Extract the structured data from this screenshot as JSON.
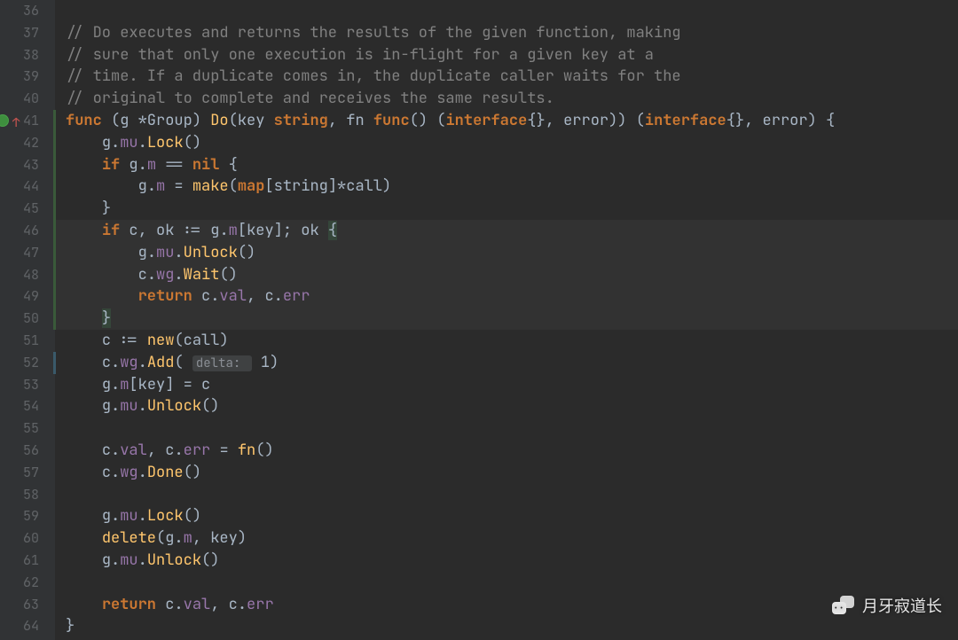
{
  "watermark": {
    "text": "月牙寂道长"
  },
  "hint": {
    "delta_label": "delta:",
    "delta_value": "1"
  },
  "gutter": {
    "start": 36,
    "marks": {
      "41": {
        "dot": true,
        "arrow": "↑"
      }
    }
  },
  "highlight": {
    "from": 46,
    "to": 50
  },
  "vbars": [
    {
      "from": 41,
      "to": 50,
      "class": ""
    },
    {
      "from": 52,
      "to": 52,
      "class": "blue"
    }
  ],
  "lines": [
    {
      "n": 36,
      "tokens": [
        {
          "t": "",
          "c": ""
        }
      ]
    },
    {
      "n": 37,
      "tokens": [
        {
          "t": "// Do executes and returns the results of the given function, making",
          "c": "c-cmt"
        }
      ]
    },
    {
      "n": 38,
      "tokens": [
        {
          "t": "// sure that only one execution is in-flight for a given key at a",
          "c": "c-cmt"
        }
      ]
    },
    {
      "n": 39,
      "tokens": [
        {
          "t": "// time. If a duplicate comes in, the duplicate caller waits for the",
          "c": "c-cmt"
        }
      ]
    },
    {
      "n": 40,
      "tokens": [
        {
          "t": "// original to complete and receives the same results.",
          "c": "c-cmt"
        }
      ]
    },
    {
      "n": 41,
      "tokens": [
        {
          "t": "func ",
          "c": "c-kw"
        },
        {
          "t": "(",
          "c": "c-punc"
        },
        {
          "t": "g ",
          "c": "c-id"
        },
        {
          "t": "*Group",
          "c": "c-ty"
        },
        {
          "t": ") ",
          "c": "c-punc"
        },
        {
          "t": "Do",
          "c": "c-fn"
        },
        {
          "t": "(",
          "c": "c-punc"
        },
        {
          "t": "key ",
          "c": "c-id"
        },
        {
          "t": "string",
          "c": "c-kw"
        },
        {
          "t": ", ",
          "c": "c-punc"
        },
        {
          "t": "fn ",
          "c": "c-id"
        },
        {
          "t": "func",
          "c": "c-kw"
        },
        {
          "t": "() (",
          "c": "c-punc"
        },
        {
          "t": "interface",
          "c": "c-kw"
        },
        {
          "t": "{}, ",
          "c": "c-punc"
        },
        {
          "t": "error",
          "c": "c-ty"
        },
        {
          "t": ")) (",
          "c": "c-punc"
        },
        {
          "t": "interface",
          "c": "c-kw"
        },
        {
          "t": "{}, ",
          "c": "c-punc"
        },
        {
          "t": "error",
          "c": "c-ty"
        },
        {
          "t": ") {",
          "c": "c-punc"
        }
      ]
    },
    {
      "n": 42,
      "indent": 1,
      "tokens": [
        {
          "t": "g",
          "c": "c-id"
        },
        {
          "t": ".",
          "c": "c-punc"
        },
        {
          "t": "mu",
          "c": "c-fld"
        },
        {
          "t": ".",
          "c": "c-punc"
        },
        {
          "t": "Lock",
          "c": "c-fn"
        },
        {
          "t": "()",
          "c": "c-punc"
        }
      ]
    },
    {
      "n": 43,
      "indent": 1,
      "tokens": [
        {
          "t": "if ",
          "c": "c-kw"
        },
        {
          "t": "g",
          "c": "c-id"
        },
        {
          "t": ".",
          "c": "c-punc"
        },
        {
          "t": "m",
          "c": "c-fld"
        },
        {
          "t": " == ",
          "c": "c-punc"
        },
        {
          "t": "nil ",
          "c": "c-kw"
        },
        {
          "t": "{",
          "c": "c-punc"
        }
      ]
    },
    {
      "n": 44,
      "indent": 2,
      "tokens": [
        {
          "t": "g",
          "c": "c-id"
        },
        {
          "t": ".",
          "c": "c-punc"
        },
        {
          "t": "m",
          "c": "c-fld"
        },
        {
          "t": " = ",
          "c": "c-punc"
        },
        {
          "t": "make",
          "c": "c-fn"
        },
        {
          "t": "(",
          "c": "c-punc"
        },
        {
          "t": "map",
          "c": "c-kw"
        },
        {
          "t": "[",
          "c": "c-punc"
        },
        {
          "t": "string",
          "c": "c-ty"
        },
        {
          "t": "]*call)",
          "c": "c-punc"
        }
      ]
    },
    {
      "n": 45,
      "indent": 1,
      "tokens": [
        {
          "t": "}",
          "c": "c-punc"
        }
      ]
    },
    {
      "n": 46,
      "indent": 1,
      "tokens": [
        {
          "t": "if ",
          "c": "c-kw"
        },
        {
          "t": "c",
          "c": "c-id"
        },
        {
          "t": ", ",
          "c": "c-punc"
        },
        {
          "t": "ok ",
          "c": "c-id"
        },
        {
          "t": ":= ",
          "c": "c-punc"
        },
        {
          "t": "g",
          "c": "c-id"
        },
        {
          "t": ".",
          "c": "c-punc"
        },
        {
          "t": "m",
          "c": "c-fld"
        },
        {
          "t": "[",
          "c": "c-punc"
        },
        {
          "t": "key",
          "c": "c-id"
        },
        {
          "t": "]; ",
          "c": "c-punc"
        },
        {
          "t": "ok ",
          "c": "c-id"
        },
        {
          "t": "{",
          "c": "c-punc c-hl"
        }
      ]
    },
    {
      "n": 47,
      "indent": 2,
      "tokens": [
        {
          "t": "g",
          "c": "c-id"
        },
        {
          "t": ".",
          "c": "c-punc"
        },
        {
          "t": "mu",
          "c": "c-fld"
        },
        {
          "t": ".",
          "c": "c-punc"
        },
        {
          "t": "Unlock",
          "c": "c-fn"
        },
        {
          "t": "()",
          "c": "c-punc"
        }
      ]
    },
    {
      "n": 48,
      "indent": 2,
      "tokens": [
        {
          "t": "c",
          "c": "c-id"
        },
        {
          "t": ".",
          "c": "c-punc"
        },
        {
          "t": "wg",
          "c": "c-fld"
        },
        {
          "t": ".",
          "c": "c-punc"
        },
        {
          "t": "Wait",
          "c": "c-fn"
        },
        {
          "t": "()",
          "c": "c-punc"
        }
      ]
    },
    {
      "n": 49,
      "indent": 2,
      "tokens": [
        {
          "t": "return ",
          "c": "c-kw"
        },
        {
          "t": "c",
          "c": "c-id"
        },
        {
          "t": ".",
          "c": "c-punc"
        },
        {
          "t": "val",
          "c": "c-fld"
        },
        {
          "t": ", ",
          "c": "c-punc"
        },
        {
          "t": "c",
          "c": "c-id"
        },
        {
          "t": ".",
          "c": "c-punc"
        },
        {
          "t": "err",
          "c": "c-fld"
        }
      ]
    },
    {
      "n": 50,
      "indent": 1,
      "tokens": [
        {
          "t": "}",
          "c": "c-punc c-hl"
        }
      ]
    },
    {
      "n": 51,
      "indent": 1,
      "tokens": [
        {
          "t": "c ",
          "c": "c-id"
        },
        {
          "t": ":= ",
          "c": "c-punc"
        },
        {
          "t": "new",
          "c": "c-fn"
        },
        {
          "t": "(",
          "c": "c-punc"
        },
        {
          "t": "call",
          "c": "c-ty"
        },
        {
          "t": ")",
          "c": "c-punc"
        }
      ]
    },
    {
      "n": 52,
      "indent": 1,
      "tokens": [
        {
          "t": "c",
          "c": "c-id"
        },
        {
          "t": ".",
          "c": "c-punc"
        },
        {
          "t": "wg",
          "c": "c-fld"
        },
        {
          "t": ".",
          "c": "c-punc"
        },
        {
          "t": "Add",
          "c": "c-fn"
        },
        {
          "t": "( ",
          "c": "c-punc"
        },
        {
          "t": "__HINT__",
          "c": "__HINT__"
        },
        {
          "t": ")",
          "c": "c-punc"
        }
      ]
    },
    {
      "n": 53,
      "indent": 1,
      "tokens": [
        {
          "t": "g",
          "c": "c-id"
        },
        {
          "t": ".",
          "c": "c-punc"
        },
        {
          "t": "m",
          "c": "c-fld"
        },
        {
          "t": "[",
          "c": "c-punc"
        },
        {
          "t": "key",
          "c": "c-id"
        },
        {
          "t": "] = ",
          "c": "c-punc"
        },
        {
          "t": "c",
          "c": "c-id"
        }
      ]
    },
    {
      "n": 54,
      "indent": 1,
      "tokens": [
        {
          "t": "g",
          "c": "c-id"
        },
        {
          "t": ".",
          "c": "c-punc"
        },
        {
          "t": "mu",
          "c": "c-fld"
        },
        {
          "t": ".",
          "c": "c-punc"
        },
        {
          "t": "Unlock",
          "c": "c-fn"
        },
        {
          "t": "()",
          "c": "c-punc"
        }
      ]
    },
    {
      "n": 55,
      "indent": 1,
      "tokens": []
    },
    {
      "n": 56,
      "indent": 1,
      "tokens": [
        {
          "t": "c",
          "c": "c-id"
        },
        {
          "t": ".",
          "c": "c-punc"
        },
        {
          "t": "val",
          "c": "c-fld"
        },
        {
          "t": ", ",
          "c": "c-punc"
        },
        {
          "t": "c",
          "c": "c-id"
        },
        {
          "t": ".",
          "c": "c-punc"
        },
        {
          "t": "err",
          "c": "c-fld"
        },
        {
          "t": " = ",
          "c": "c-punc"
        },
        {
          "t": "fn",
          "c": "c-fn"
        },
        {
          "t": "()",
          "c": "c-punc"
        }
      ]
    },
    {
      "n": 57,
      "indent": 1,
      "tokens": [
        {
          "t": "c",
          "c": "c-id"
        },
        {
          "t": ".",
          "c": "c-punc"
        },
        {
          "t": "wg",
          "c": "c-fld"
        },
        {
          "t": ".",
          "c": "c-punc"
        },
        {
          "t": "Done",
          "c": "c-fn"
        },
        {
          "t": "()",
          "c": "c-punc"
        }
      ]
    },
    {
      "n": 58,
      "indent": 1,
      "tokens": []
    },
    {
      "n": 59,
      "indent": 1,
      "tokens": [
        {
          "t": "g",
          "c": "c-id"
        },
        {
          "t": ".",
          "c": "c-punc"
        },
        {
          "t": "mu",
          "c": "c-fld"
        },
        {
          "t": ".",
          "c": "c-punc"
        },
        {
          "t": "Lock",
          "c": "c-fn"
        },
        {
          "t": "()",
          "c": "c-punc"
        }
      ]
    },
    {
      "n": 60,
      "indent": 1,
      "tokens": [
        {
          "t": "delete",
          "c": "c-fn"
        },
        {
          "t": "(",
          "c": "c-punc"
        },
        {
          "t": "g",
          "c": "c-id"
        },
        {
          "t": ".",
          "c": "c-punc"
        },
        {
          "t": "m",
          "c": "c-fld"
        },
        {
          "t": ", ",
          "c": "c-punc"
        },
        {
          "t": "key",
          "c": "c-id"
        },
        {
          "t": ")",
          "c": "c-punc"
        }
      ]
    },
    {
      "n": 61,
      "indent": 1,
      "tokens": [
        {
          "t": "g",
          "c": "c-id"
        },
        {
          "t": ".",
          "c": "c-punc"
        },
        {
          "t": "mu",
          "c": "c-fld"
        },
        {
          "t": ".",
          "c": "c-punc"
        },
        {
          "t": "Unlock",
          "c": "c-fn"
        },
        {
          "t": "()",
          "c": "c-punc"
        }
      ]
    },
    {
      "n": 62,
      "indent": 1,
      "tokens": []
    },
    {
      "n": 63,
      "indent": 1,
      "tokens": [
        {
          "t": "return ",
          "c": "c-kw"
        },
        {
          "t": "c",
          "c": "c-id"
        },
        {
          "t": ".",
          "c": "c-punc"
        },
        {
          "t": "val",
          "c": "c-fld"
        },
        {
          "t": ", ",
          "c": "c-punc"
        },
        {
          "t": "c",
          "c": "c-id"
        },
        {
          "t": ".",
          "c": "c-punc"
        },
        {
          "t": "err",
          "c": "c-fld"
        }
      ]
    },
    {
      "n": 64,
      "indent": 0,
      "tokens": [
        {
          "t": "}",
          "c": "c-punc"
        }
      ]
    }
  ]
}
